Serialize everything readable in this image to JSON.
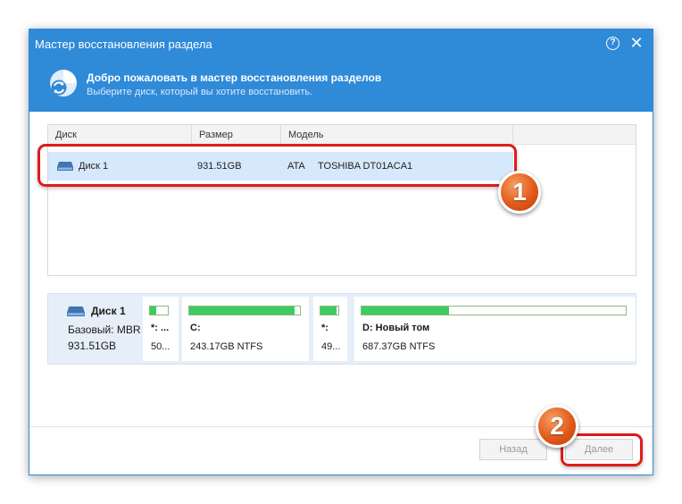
{
  "window": {
    "title": "Мастер восстановления раздела",
    "help_glyph": "?",
    "close_glyph": "✕"
  },
  "banner": {
    "title": "Добро пожаловать в мастер восстановления разделов",
    "subtitle": "Выберите диск, который вы хотите восстановить.",
    "icon": "partition-recovery-icon"
  },
  "disk_table": {
    "columns": [
      "Диск",
      "Размер",
      "Модель"
    ],
    "rows": [
      {
        "disk": "Диск 1",
        "size": "931.51GB",
        "interface": "ATA",
        "model": "TOSHIBA DT01ACA1",
        "selected": true
      }
    ]
  },
  "disk_map": {
    "name": "Диск 1",
    "type": "Базовый: MBR",
    "size": "931.51GB",
    "partitions": [
      {
        "label": "*: ...",
        "info": "50...",
        "used_fraction": 0.35
      },
      {
        "label": "C:",
        "info": "243.17GB NTFS",
        "used_fraction": 0.95
      },
      {
        "label": "*:",
        "info": "49...",
        "used_fraction": 0.9
      },
      {
        "label": "D: Новый том",
        "info": "687.37GB NTFS",
        "used_fraction": 0.33
      }
    ]
  },
  "buttons": {
    "back": "Назад",
    "next": "Далее"
  },
  "callouts": [
    "1",
    "2"
  ],
  "colors": {
    "accent": "#2f8ad8",
    "selected_row": "#d6e8fb",
    "partition_fill": "#3ecb63",
    "callout_red": "#e01b1b",
    "badge_orange": "#e35a1a"
  }
}
